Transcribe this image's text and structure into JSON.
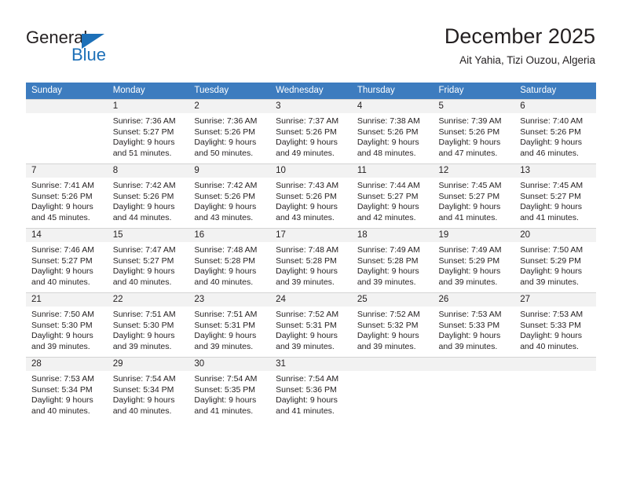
{
  "brand": {
    "word_top": "General",
    "word_bottom": "Blue",
    "triangle_color": "#1d70b8",
    "icon": "general-blue-logo"
  },
  "header": {
    "title": "December 2025",
    "subtitle": "Ait Yahia, Tizi Ouzou, Algeria"
  },
  "theme": {
    "header_row_bg": "#3d7cbf",
    "header_row_text": "#ffffff",
    "daynum_bg": "#f2f2f2",
    "grid_line": "#d4d4d4",
    "text": "#231f20"
  },
  "weekday_headers": [
    "Sunday",
    "Monday",
    "Tuesday",
    "Wednesday",
    "Thursday",
    "Friday",
    "Saturday"
  ],
  "weeks": [
    [
      {
        "day": "",
        "lines": []
      },
      {
        "day": "1",
        "lines": [
          "Sunrise: 7:36 AM",
          "Sunset: 5:27 PM",
          "Daylight: 9 hours",
          "and 51 minutes."
        ]
      },
      {
        "day": "2",
        "lines": [
          "Sunrise: 7:36 AM",
          "Sunset: 5:26 PM",
          "Daylight: 9 hours",
          "and 50 minutes."
        ]
      },
      {
        "day": "3",
        "lines": [
          "Sunrise: 7:37 AM",
          "Sunset: 5:26 PM",
          "Daylight: 9 hours",
          "and 49 minutes."
        ]
      },
      {
        "day": "4",
        "lines": [
          "Sunrise: 7:38 AM",
          "Sunset: 5:26 PM",
          "Daylight: 9 hours",
          "and 48 minutes."
        ]
      },
      {
        "day": "5",
        "lines": [
          "Sunrise: 7:39 AM",
          "Sunset: 5:26 PM",
          "Daylight: 9 hours",
          "and 47 minutes."
        ]
      },
      {
        "day": "6",
        "lines": [
          "Sunrise: 7:40 AM",
          "Sunset: 5:26 PM",
          "Daylight: 9 hours",
          "and 46 minutes."
        ]
      }
    ],
    [
      {
        "day": "7",
        "lines": [
          "Sunrise: 7:41 AM",
          "Sunset: 5:26 PM",
          "Daylight: 9 hours",
          "and 45 minutes."
        ]
      },
      {
        "day": "8",
        "lines": [
          "Sunrise: 7:42 AM",
          "Sunset: 5:26 PM",
          "Daylight: 9 hours",
          "and 44 minutes."
        ]
      },
      {
        "day": "9",
        "lines": [
          "Sunrise: 7:42 AM",
          "Sunset: 5:26 PM",
          "Daylight: 9 hours",
          "and 43 minutes."
        ]
      },
      {
        "day": "10",
        "lines": [
          "Sunrise: 7:43 AM",
          "Sunset: 5:26 PM",
          "Daylight: 9 hours",
          "and 43 minutes."
        ]
      },
      {
        "day": "11",
        "lines": [
          "Sunrise: 7:44 AM",
          "Sunset: 5:27 PM",
          "Daylight: 9 hours",
          "and 42 minutes."
        ]
      },
      {
        "day": "12",
        "lines": [
          "Sunrise: 7:45 AM",
          "Sunset: 5:27 PM",
          "Daylight: 9 hours",
          "and 41 minutes."
        ]
      },
      {
        "day": "13",
        "lines": [
          "Sunrise: 7:45 AM",
          "Sunset: 5:27 PM",
          "Daylight: 9 hours",
          "and 41 minutes."
        ]
      }
    ],
    [
      {
        "day": "14",
        "lines": [
          "Sunrise: 7:46 AM",
          "Sunset: 5:27 PM",
          "Daylight: 9 hours",
          "and 40 minutes."
        ]
      },
      {
        "day": "15",
        "lines": [
          "Sunrise: 7:47 AM",
          "Sunset: 5:27 PM",
          "Daylight: 9 hours",
          "and 40 minutes."
        ]
      },
      {
        "day": "16",
        "lines": [
          "Sunrise: 7:48 AM",
          "Sunset: 5:28 PM",
          "Daylight: 9 hours",
          "and 40 minutes."
        ]
      },
      {
        "day": "17",
        "lines": [
          "Sunrise: 7:48 AM",
          "Sunset: 5:28 PM",
          "Daylight: 9 hours",
          "and 39 minutes."
        ]
      },
      {
        "day": "18",
        "lines": [
          "Sunrise: 7:49 AM",
          "Sunset: 5:28 PM",
          "Daylight: 9 hours",
          "and 39 minutes."
        ]
      },
      {
        "day": "19",
        "lines": [
          "Sunrise: 7:49 AM",
          "Sunset: 5:29 PM",
          "Daylight: 9 hours",
          "and 39 minutes."
        ]
      },
      {
        "day": "20",
        "lines": [
          "Sunrise: 7:50 AM",
          "Sunset: 5:29 PM",
          "Daylight: 9 hours",
          "and 39 minutes."
        ]
      }
    ],
    [
      {
        "day": "21",
        "lines": [
          "Sunrise: 7:50 AM",
          "Sunset: 5:30 PM",
          "Daylight: 9 hours",
          "and 39 minutes."
        ]
      },
      {
        "day": "22",
        "lines": [
          "Sunrise: 7:51 AM",
          "Sunset: 5:30 PM",
          "Daylight: 9 hours",
          "and 39 minutes."
        ]
      },
      {
        "day": "23",
        "lines": [
          "Sunrise: 7:51 AM",
          "Sunset: 5:31 PM",
          "Daylight: 9 hours",
          "and 39 minutes."
        ]
      },
      {
        "day": "24",
        "lines": [
          "Sunrise: 7:52 AM",
          "Sunset: 5:31 PM",
          "Daylight: 9 hours",
          "and 39 minutes."
        ]
      },
      {
        "day": "25",
        "lines": [
          "Sunrise: 7:52 AM",
          "Sunset: 5:32 PM",
          "Daylight: 9 hours",
          "and 39 minutes."
        ]
      },
      {
        "day": "26",
        "lines": [
          "Sunrise: 7:53 AM",
          "Sunset: 5:33 PM",
          "Daylight: 9 hours",
          "and 39 minutes."
        ]
      },
      {
        "day": "27",
        "lines": [
          "Sunrise: 7:53 AM",
          "Sunset: 5:33 PM",
          "Daylight: 9 hours",
          "and 40 minutes."
        ]
      }
    ],
    [
      {
        "day": "28",
        "lines": [
          "Sunrise: 7:53 AM",
          "Sunset: 5:34 PM",
          "Daylight: 9 hours",
          "and 40 minutes."
        ]
      },
      {
        "day": "29",
        "lines": [
          "Sunrise: 7:54 AM",
          "Sunset: 5:34 PM",
          "Daylight: 9 hours",
          "and 40 minutes."
        ]
      },
      {
        "day": "30",
        "lines": [
          "Sunrise: 7:54 AM",
          "Sunset: 5:35 PM",
          "Daylight: 9 hours",
          "and 41 minutes."
        ]
      },
      {
        "day": "31",
        "lines": [
          "Sunrise: 7:54 AM",
          "Sunset: 5:36 PM",
          "Daylight: 9 hours",
          "and 41 minutes."
        ]
      },
      {
        "day": "",
        "lines": []
      },
      {
        "day": "",
        "lines": []
      },
      {
        "day": "",
        "lines": []
      }
    ]
  ]
}
